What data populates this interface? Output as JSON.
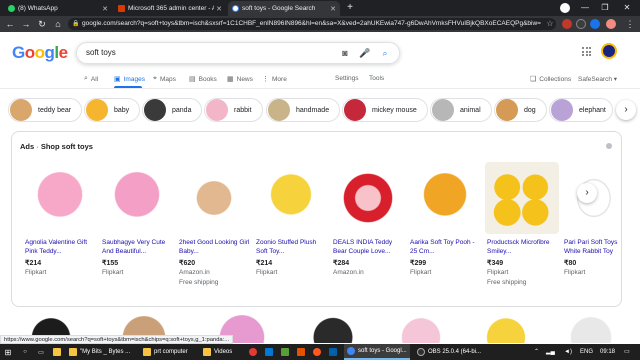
{
  "browser": {
    "tabs": [
      {
        "title": "(8) WhatsApp",
        "icon": "whatsapp-icon",
        "color": "#25d366"
      },
      {
        "title": "Microsoft 365 admin center - Ac",
        "icon": "office-icon",
        "color": "#d83b01"
      },
      {
        "title": "soft toys - Google Search",
        "icon": "google-icon",
        "color": "#ffffff",
        "active": true
      }
    ],
    "url": "google.com/search?q=soft+toys&tbm=isch&sxsrf=1C1CHBF_enIN896IN896&hl=en&sa=X&ved=2ahUKEwia747-g6DwAhVmksFHVuIBjkQBXoECAEQPg&biw="
  },
  "search": {
    "logo": "Google",
    "query": "soft toys",
    "tabs": [
      {
        "label": "All",
        "icon": "search-icon"
      },
      {
        "label": "Images",
        "icon": "image-icon",
        "active": true
      },
      {
        "label": "Maps",
        "icon": "map-pin-icon"
      },
      {
        "label": "Books",
        "icon": "book-icon"
      },
      {
        "label": "News",
        "icon": "news-icon"
      },
      {
        "label": "More",
        "icon": "more-vert-icon"
      }
    ],
    "settings": "Settings",
    "tools": "Tools",
    "collections": "Collections",
    "safesearch": "SafeSearch ▾"
  },
  "chips": [
    {
      "label": "teddy bear",
      "color": "#d9a66b"
    },
    {
      "label": "baby",
      "color": "#f5b52e"
    },
    {
      "label": "panda",
      "color": "#3a3a3a"
    },
    {
      "label": "rabbit",
      "color": "#f3b5c8"
    },
    {
      "label": "handmade",
      "color": "#c9b48a"
    },
    {
      "label": "mickey mouse",
      "color": "#c4283a"
    },
    {
      "label": "animal",
      "color": "#b7b7b7"
    },
    {
      "label": "dog",
      "color": "#d59a55"
    },
    {
      "label": "elephant",
      "color": "#b8a2d6"
    }
  ],
  "ads": {
    "prefix": "Ads",
    "title": "Shop soft toys",
    "products": [
      {
        "name": "Agnolia Valentine Gift Pink Teddy...",
        "price": "₹214",
        "merchant": "Flipkart",
        "shipping": "",
        "color": "#f7a8c8"
      },
      {
        "name": "Saubhagye Very Cute And Beautiful...",
        "price": "₹155",
        "merchant": "Flipkart",
        "shipping": "",
        "color": "#f4a0c6"
      },
      {
        "name": "2heet Good Looking Girl Baby...",
        "price": "₹620",
        "merchant": "Amazon.in",
        "shipping": "Free shipping",
        "color": "#e2b890"
      },
      {
        "name": "Zoonio Stuffed Plush Soft Toy...",
        "price": "₹214",
        "merchant": "Flipkart",
        "shipping": "",
        "color": "#f6d33c"
      },
      {
        "name": "DEALS INDIA Teddy Bear Couple Love...",
        "price": "₹284",
        "merchant": "Amazon.in",
        "shipping": "",
        "color": "#d7202c"
      },
      {
        "name": "Aarika Soft Toy Pooh - 25 Cm...",
        "price": "₹299",
        "merchant": "Flipkart",
        "shipping": "",
        "color": "#f0a524"
      },
      {
        "name": "Productsck Microfibre Smiley...",
        "price": "₹349",
        "merchant": "Flipkart",
        "shipping": "Free shipping",
        "color": "#f5c21b"
      },
      {
        "name": "Pari Pari Soft Toys White Rabbit Toy -...",
        "price": "₹80",
        "merchant": "Flipkart",
        "shipping": "",
        "color": "#f2f2f2"
      }
    ]
  },
  "bottom_images": [
    {
      "color": "#1c1c1c"
    },
    {
      "color": "#c9a077"
    },
    {
      "color": "#e79ad0"
    },
    {
      "color": "#2a2a2a"
    },
    {
      "color": "#f4c6d8"
    },
    {
      "color": "#f6d33c"
    },
    {
      "color": "#e8e8e8"
    }
  ],
  "status_url": "https://www.google.com/search?q=soft+toys&tbm=isch&chips=q:soft+toys,g_1:panda:...",
  "taskbar": {
    "items": [
      {
        "label": "\"My Bits _ Bytes ...",
        "color": "#f6c343"
      },
      {
        "label": "prt computer",
        "color": "#f6c343"
      },
      {
        "label": "Videos",
        "color": "#f6c343"
      },
      {
        "label": "soft toys - Googl...",
        "color": "#4285f4",
        "active": true
      },
      {
        "label": "OBS 25.0.4 (64-bi...",
        "color": "#302e31"
      }
    ],
    "lang": "ENG",
    "time": "09:18"
  }
}
